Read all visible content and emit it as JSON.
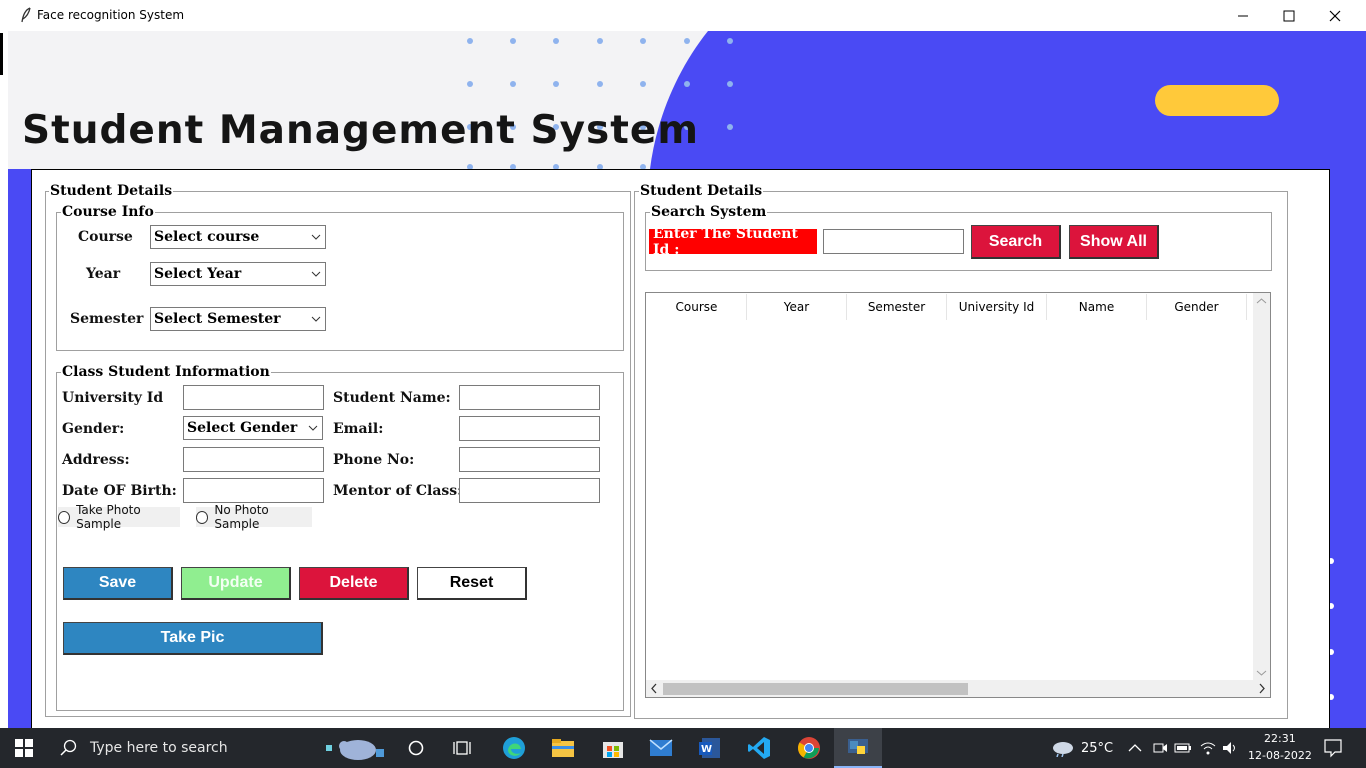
{
  "window": {
    "title": "Face recognition System"
  },
  "header": {
    "title": "Student Management System"
  },
  "left_panel": {
    "legend": "Student Details",
    "course_info": {
      "legend": "Course Info",
      "course_label": "Course",
      "course_value": "Select course",
      "year_label": "Year",
      "year_value": "Select Year",
      "semester_label": "Semester",
      "semester_value": "Select Semester"
    },
    "class_info": {
      "legend": "Class Student Information",
      "university_id_label": "University Id",
      "student_name_label": "Student Name:",
      "gender_label": "Gender:",
      "gender_value": "Select Gender",
      "email_label": "Email:",
      "address_label": "Address:",
      "phone_label": "Phone No:",
      "dob_label": "Date OF Birth:",
      "mentor_label": "Mentor of Class:",
      "radio_take_photo": "Take Photo Sample",
      "radio_no_photo": "No Photo Sample"
    },
    "buttons": {
      "save": "Save",
      "update": "Update",
      "delete": "Delete",
      "reset": "Reset",
      "take_pic": "Take Pic"
    }
  },
  "right_panel": {
    "legend": "Student Details",
    "search": {
      "legend": "Search System",
      "label": "Enter The Student Id :",
      "search_button": "Search",
      "show_all_button": "Show All"
    },
    "table": {
      "columns": [
        "Course",
        "Year",
        "Semester",
        "University Id",
        "Name",
        "Gender"
      ],
      "rows": []
    }
  },
  "taskbar": {
    "search_placeholder": "Type here to search",
    "weather": "25°C",
    "time": "22:31",
    "date": "12-08-2022"
  },
  "colors": {
    "accent_blue": "#4a4af4",
    "yellow": "#ffc93a",
    "save_button": "#2e86c1",
    "update_button": "#90ee90",
    "delete_button": "#dc143c",
    "search_label_bg": "#ff0000"
  }
}
